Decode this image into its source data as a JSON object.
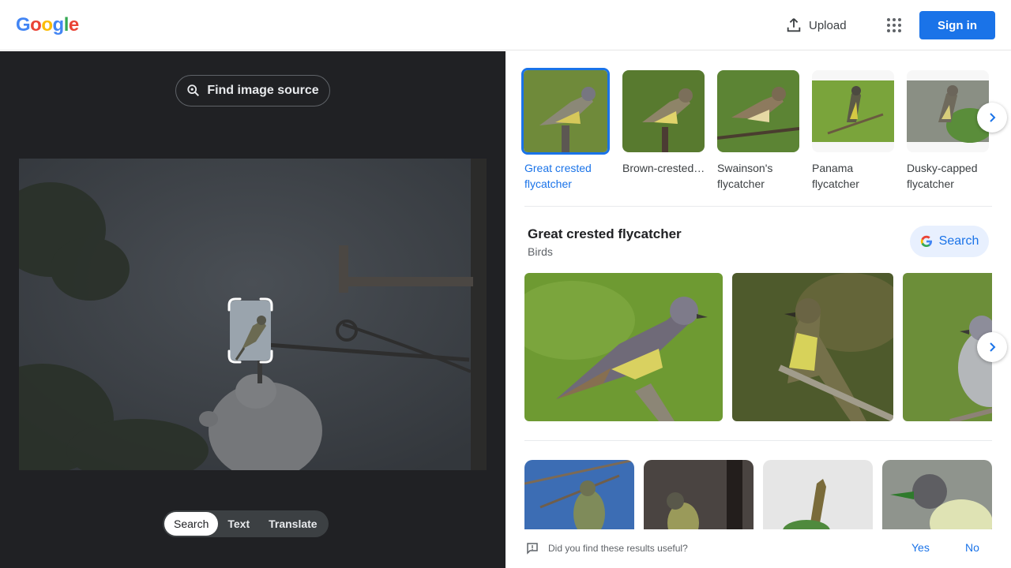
{
  "header": {
    "logo_letters": [
      "G",
      "o",
      "o",
      "g",
      "l",
      "e"
    ],
    "logo_colors": [
      "#4285f4",
      "#ea4335",
      "#fbbc05",
      "#4285f4",
      "#34a853",
      "#ea4335"
    ],
    "upload_label": "Upload",
    "signin_label": "Sign in",
    "icons": {
      "upload": "upload-icon",
      "apps": "apps-grid-icon"
    }
  },
  "left_pane": {
    "find_source_label": "Find image source",
    "mode_tabs": [
      {
        "label": "Search",
        "active": true
      },
      {
        "label": "Text",
        "active": false
      },
      {
        "label": "Translate",
        "active": false
      }
    ]
  },
  "visual_matches": [
    {
      "label": "Great crested flycatcher",
      "selected": true
    },
    {
      "label": "Brown-crested…",
      "selected": false
    },
    {
      "label": "Swainson's flycatcher",
      "selected": false
    },
    {
      "label": "Panama flycatcher",
      "selected": false
    },
    {
      "label": "Dusky-capped flycatcher",
      "selected": false
    }
  ],
  "knowledge": {
    "title": "Great crested flycatcher",
    "subtitle": "Birds",
    "search_label": "Search"
  },
  "feedback": {
    "question": "Did you find these results useful?",
    "yes_label": "Yes",
    "no_label": "No"
  },
  "colors": {
    "accent": "#1a73e8",
    "dark_bg": "#202124"
  }
}
